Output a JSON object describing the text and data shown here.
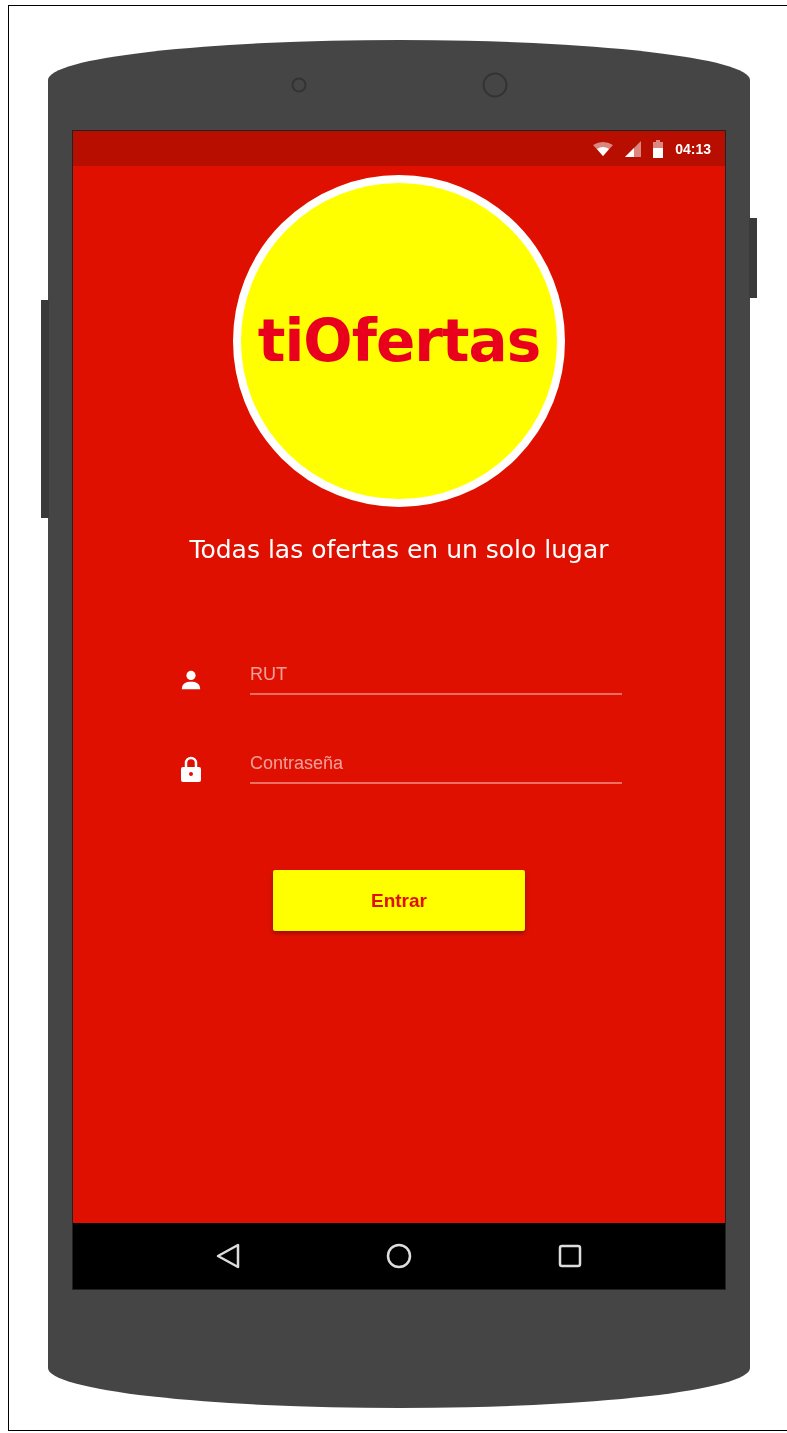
{
  "status_bar": {
    "time": "04:13"
  },
  "logo": {
    "text": "tiOfertas"
  },
  "tagline": "Todas las ofertas en un solo lugar",
  "fields": [
    {
      "kind": "user",
      "placeholder": "RUT"
    },
    {
      "kind": "lock",
      "placeholder": "Contraseña"
    }
  ],
  "login_button": {
    "label": "Entrar"
  }
}
